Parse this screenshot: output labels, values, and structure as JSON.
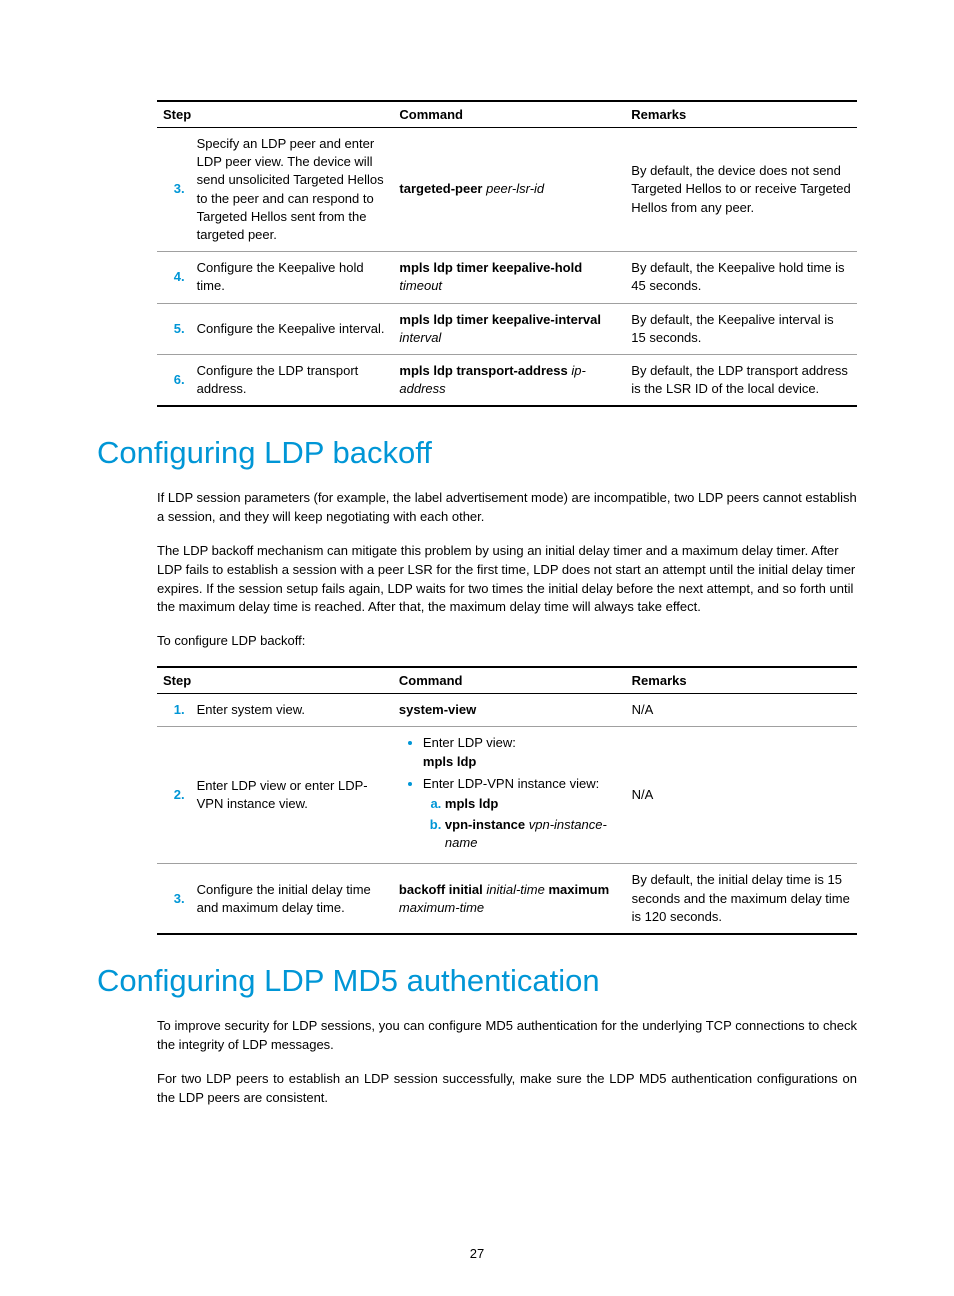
{
  "table1": {
    "headers": {
      "step": "Step",
      "command": "Command",
      "remarks": "Remarks"
    },
    "rows": [
      {
        "num": "3.",
        "step": "Specify an LDP peer and enter LDP peer view. The device will send unsolicited Targeted Hellos to the peer and can respond to Targeted Hellos sent from the targeted peer.",
        "cmd_b": "targeted-peer",
        "cmd_i": " peer-lsr-id",
        "remarks": "By default, the device does not send Targeted Hellos to or receive Targeted Hellos from any peer."
      },
      {
        "num": "4.",
        "step": "Configure the Keepalive hold time.",
        "cmd_b": "mpls ldp timer keepalive-hold",
        "cmd_i": "timeout",
        "remarks": "By default, the Keepalive hold time is 45 seconds."
      },
      {
        "num": "5.",
        "step": "Configure the Keepalive interval.",
        "cmd_b": "mpls ldp timer keepalive-interval",
        "cmd_i": "interval",
        "remarks": "By default, the Keepalive interval is 15 seconds."
      },
      {
        "num": "6.",
        "step": "Configure the LDP transport address.",
        "cmd_b": "mpls ldp transport-address",
        "cmd_i": "ip-address",
        "remarks": "By default, the LDP transport address is the LSR ID of the local device."
      }
    ]
  },
  "section1": {
    "heading": "Configuring LDP backoff",
    "p1": "If LDP session parameters (for example, the label advertisement mode) are incompatible, two LDP peers cannot establish a session, and they will keep negotiating with each other.",
    "p2": "The LDP backoff mechanism can mitigate this problem by using an initial delay timer and a maximum delay timer. After LDP fails to establish a session with a peer LSR for the first time, LDP does not start an attempt until the initial delay timer expires. If the session setup fails again, LDP waits for two times the initial delay before the next attempt, and so forth until the maximum delay time is reached. After that, the maximum delay time will always take effect.",
    "p3": "To configure LDP backoff:"
  },
  "table2": {
    "headers": {
      "step": "Step",
      "command": "Command",
      "remarks": "Remarks"
    },
    "row1": {
      "num": "1.",
      "step": "Enter system view.",
      "cmd": "system-view",
      "remarks": "N/A"
    },
    "row2": {
      "num": "2.",
      "step": "Enter LDP view or enter LDP-VPN instance view.",
      "li1_text": "Enter LDP view:",
      "li1_cmd": "mpls ldp",
      "li2_text": "Enter LDP-VPN instance view:",
      "li2_a": "mpls ldp",
      "li2_b_bold": "vpn-instance",
      "li2_b_italic": "vpn-instance-name",
      "remarks": "N/A"
    },
    "row3": {
      "num": "3.",
      "step": "Configure the initial delay time and maximum delay time.",
      "cmd_b1": "backoff initial",
      "cmd_i1": " initial-time ",
      "cmd_b2": "maximum",
      "cmd_i2": "maximum-time",
      "remarks": "By default, the initial delay time is 15 seconds and the maximum delay time is 120 seconds."
    }
  },
  "section2": {
    "heading": "Configuring LDP MD5 authentication",
    "p1": "To improve security for LDP sessions, you can configure MD5 authentication for the underlying TCP connections to check the integrity of LDP messages.",
    "p2": "For two LDP peers to establish an LDP session successfully, make sure the LDP MD5 authentication configurations on the LDP peers are consistent."
  },
  "page_number": "27"
}
